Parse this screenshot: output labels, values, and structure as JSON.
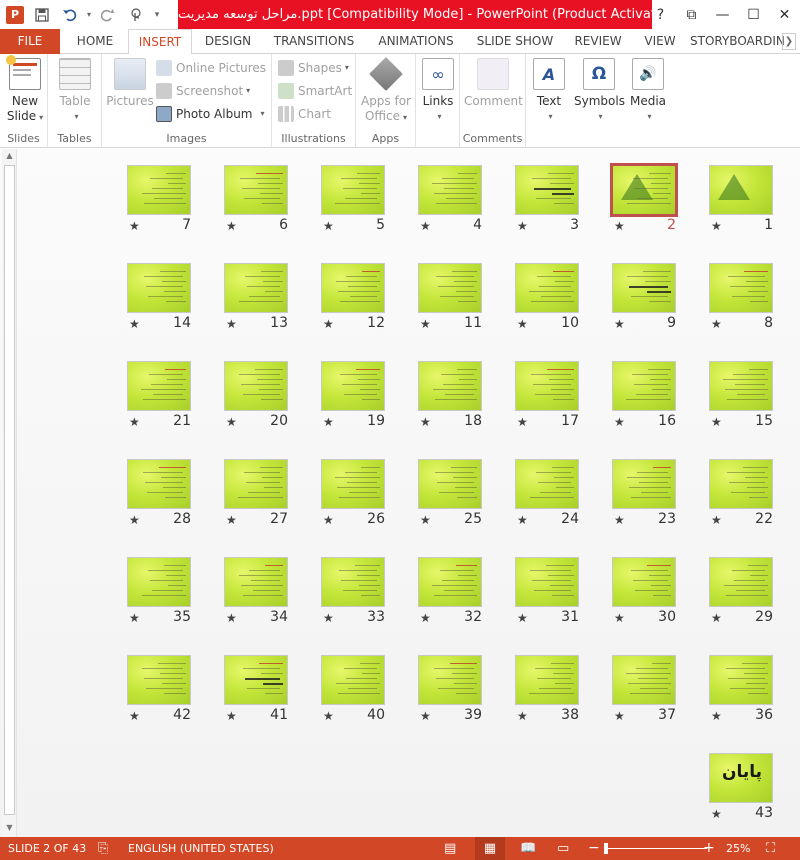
{
  "titlebar": {
    "app_icon": "P",
    "title": "مراحل توسعه مدیریت.ppt [Compatibility Mode] -  PowerPoint (Product Activation Fail...",
    "qat": [
      "save-icon",
      "undo-icon",
      "redo-icon",
      "touch-mode-icon"
    ],
    "window_controls": {
      "help": "?",
      "ribbon_options": "⧉",
      "minimize": "—",
      "maximize": "☐",
      "close": "✕"
    }
  },
  "tabs": {
    "file": "FILE",
    "home": "HOME",
    "insert": "INSERT",
    "design": "DESIGN",
    "transitions": "TRANSITIONS",
    "animations": "ANIMATIONS",
    "slideshow": "SLIDE SHOW",
    "review": "REVIEW",
    "view": "VIEW",
    "storyboarding": "STORYBOARDIN"
  },
  "ribbon": {
    "slides": {
      "label": "Slides",
      "new_slide_line1": "New",
      "new_slide_line2": "Slide"
    },
    "tables": {
      "label": "Tables",
      "table": "Table"
    },
    "images": {
      "label": "Images",
      "pictures": "Pictures",
      "online_pictures": "Online Pictures",
      "screenshot": "Screenshot",
      "photo_album": "Photo Album"
    },
    "illustrations": {
      "label": "Illustrations",
      "shapes": "Shapes",
      "smartart": "SmartArt",
      "chart": "Chart"
    },
    "apps": {
      "label": "Apps",
      "apps_line1": "Apps for",
      "apps_line2": "Office"
    },
    "links": {
      "label": "",
      "links": "Links"
    },
    "comments": {
      "label": "Comments",
      "comment": "Comment"
    },
    "text": {
      "label": "",
      "text": "Text"
    },
    "symbols": {
      "label": "",
      "symbols": "Symbols"
    },
    "media": {
      "label": "",
      "media": "Media"
    }
  },
  "slides": [
    {
      "n": "1"
    },
    {
      "n": "2"
    },
    {
      "n": "3"
    },
    {
      "n": "4"
    },
    {
      "n": "5"
    },
    {
      "n": "6"
    },
    {
      "n": "7"
    },
    {
      "n": "8"
    },
    {
      "n": "9"
    },
    {
      "n": "10"
    },
    {
      "n": "11"
    },
    {
      "n": "12"
    },
    {
      "n": "13"
    },
    {
      "n": "14"
    },
    {
      "n": "15"
    },
    {
      "n": "16"
    },
    {
      "n": "17"
    },
    {
      "n": "18"
    },
    {
      "n": "19"
    },
    {
      "n": "20"
    },
    {
      "n": "21"
    },
    {
      "n": "22"
    },
    {
      "n": "23"
    },
    {
      "n": "24"
    },
    {
      "n": "25"
    },
    {
      "n": "26"
    },
    {
      "n": "27"
    },
    {
      "n": "28"
    },
    {
      "n": "29"
    },
    {
      "n": "30"
    },
    {
      "n": "31"
    },
    {
      "n": "32"
    },
    {
      "n": "33"
    },
    {
      "n": "34"
    },
    {
      "n": "35"
    },
    {
      "n": "36"
    },
    {
      "n": "37"
    },
    {
      "n": "38"
    },
    {
      "n": "39"
    },
    {
      "n": "40"
    },
    {
      "n": "41"
    },
    {
      "n": "42"
    },
    {
      "n": "43",
      "text": "پایان"
    }
  ],
  "selected_slide": 2,
  "star": "★",
  "statusbar": {
    "slide_info": "SLIDE 2 OF 43",
    "language": "ENGLISH (UNITED STATES)",
    "zoom": "25%",
    "zoom_out": "−",
    "zoom_in": "+"
  }
}
